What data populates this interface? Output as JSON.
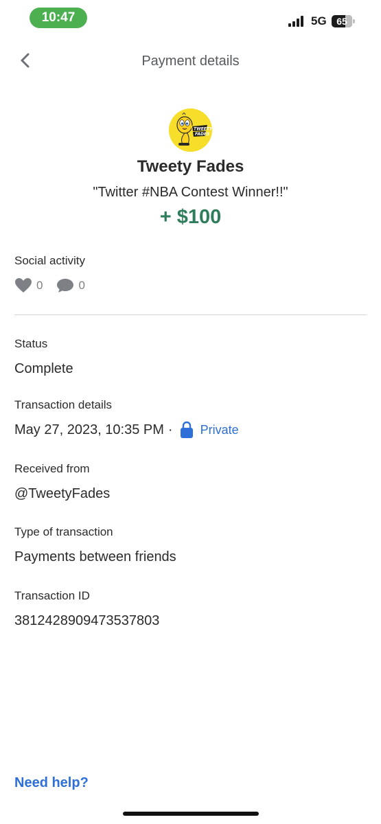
{
  "status_bar": {
    "time": "10:47",
    "network": "5G",
    "battery_percent": "65",
    "battery_level": 0.65
  },
  "header": {
    "title": "Payment details",
    "back_icon": "chevron-left-icon"
  },
  "counterparty": {
    "name": "Tweety Fades",
    "note": "\"Twitter #NBA Contest Winner!!\"",
    "amount": "+ $100",
    "amount_color": "#2e7d5b"
  },
  "social": {
    "label": "Social activity",
    "likes": "0",
    "comments": "0"
  },
  "details": {
    "status": {
      "label": "Status",
      "value": "Complete"
    },
    "transaction_details": {
      "label": "Transaction details",
      "date": "May 27, 2023, 10:35 PM",
      "separator": "·",
      "privacy": "Private"
    },
    "received_from": {
      "label": "Received from",
      "value": "@TweetyFades"
    },
    "type": {
      "label": "Type of transaction",
      "value": "Payments between friends"
    },
    "transaction_id": {
      "label": "Transaction ID",
      "value": "3812428909473537803"
    }
  },
  "help": {
    "label": "Need help?"
  },
  "colors": {
    "link": "#2e6fd8",
    "time_pill": "#4caf50"
  }
}
